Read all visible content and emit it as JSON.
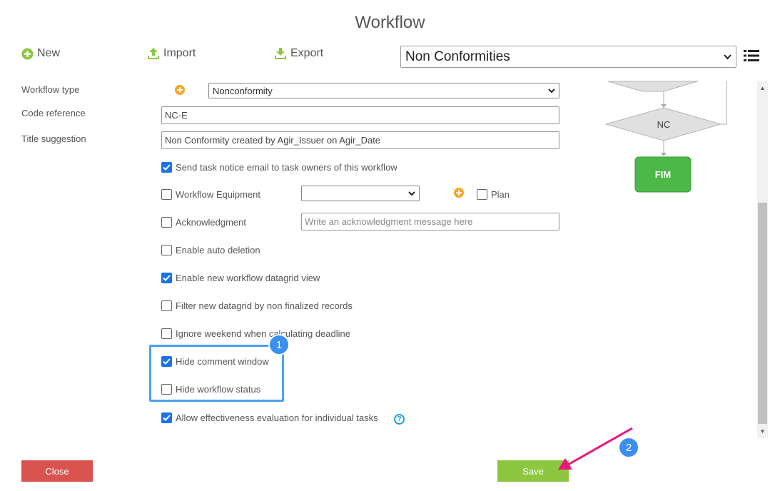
{
  "page": {
    "title": "Workflow"
  },
  "toolbar": {
    "new_label": "New",
    "import_label": "Import",
    "export_label": "Export",
    "workflow_selected": "Non Conformities"
  },
  "form": {
    "workflow_type_label": "Workflow type",
    "workflow_type_value": "Nonconformity",
    "code_reference_label": "Code reference",
    "code_reference_value": "NC-E",
    "title_suggestion_label": "Title suggestion",
    "title_suggestion_value": "Non Conformity created by Agir_Issuer on Agir_Date",
    "equipment_value": "",
    "plan_label": "Plan",
    "acknowledgment_placeholder": "Write an acknowledgment message here",
    "checkboxes": [
      {
        "label": "Send task notice email to task owners of this workflow",
        "checked": true
      },
      {
        "label": "Workflow Equipment",
        "checked": false
      },
      {
        "label": "Acknowledgment",
        "checked": false
      },
      {
        "label": "Enable auto deletion",
        "checked": false
      },
      {
        "label": "Enable new workflow datagrid view",
        "checked": true
      },
      {
        "label": "Filter new datagrid by non finalized records",
        "checked": false
      },
      {
        "label": "Ignore weekend when calculating deadline",
        "checked": false
      },
      {
        "label": "Hide comment window",
        "checked": true
      },
      {
        "label": "Hide workflow status",
        "checked": false
      },
      {
        "label": "Allow effectiveness evaluation for individual tasks",
        "checked": true
      }
    ]
  },
  "diagram": {
    "decision_label": "NC",
    "end_label": "FIM"
  },
  "annotations": {
    "badge1": "1",
    "badge2": "2"
  },
  "footer": {
    "close_label": "Close",
    "save_label": "Save"
  },
  "colors": {
    "accent": "#1a73e8",
    "close": "#d9534f",
    "save": "#8dc63f",
    "diagram_end": "#4cb848",
    "annotation_arrow": "#e8177d"
  }
}
